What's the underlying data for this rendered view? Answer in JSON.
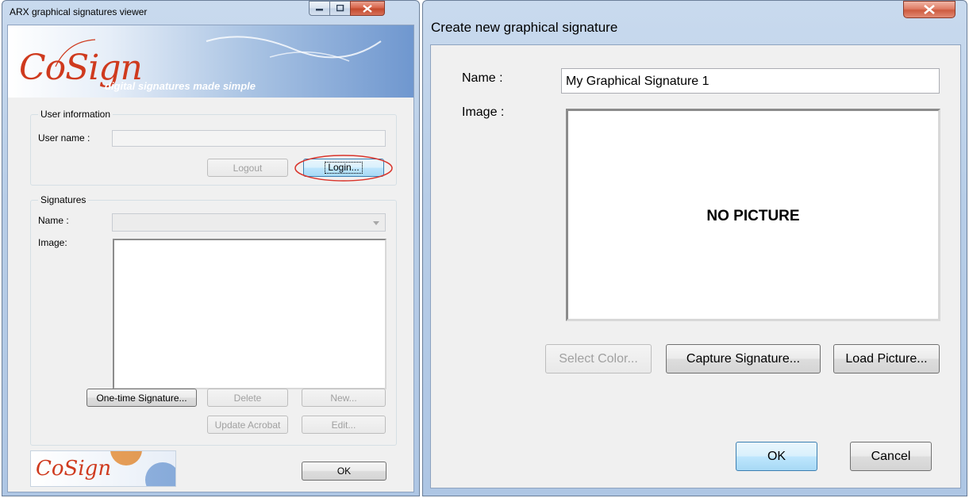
{
  "viewer": {
    "title": "ARX graphical signatures viewer",
    "logo_brand": "CoSign",
    "logo_tagline": "digital signatures made simple",
    "user_group_label": "User information",
    "username_label": "User name :",
    "username_value": "",
    "logout_label": "Logout",
    "login_label": "Login...",
    "sig_group_label": "Signatures",
    "name_label": "Name :",
    "name_value": "",
    "image_label": "Image:",
    "one_time_label": "One-time Signature...",
    "delete_label": "Delete",
    "new_label": "New...",
    "update_acrobat_label": "Update Acrobat",
    "edit_label": "Edit...",
    "footer_brand": "CoSign",
    "ok_label": "OK"
  },
  "create": {
    "title": "Create new graphical signature",
    "name_label": "Name :",
    "name_value": "My Graphical Signature 1",
    "image_label": "Image :",
    "no_picture": "NO PICTURE",
    "select_color_label": "Select Color...",
    "capture_label": "Capture Signature...",
    "load_label": "Load Picture...",
    "ok_label": "OK",
    "cancel_label": "Cancel"
  },
  "colors": {
    "window_frame": "#b7cde7",
    "client_bg": "#f0f0f0",
    "close_button": "#c44a2d",
    "login_highlight_ellipse": "#d9342b",
    "logo_red": "#cf3a1e",
    "logo_blue": "#3f7cc4"
  },
  "icons": [
    "minimize-icon",
    "maximize-icon",
    "close-icon",
    "dropdown-arrow-icon"
  ]
}
